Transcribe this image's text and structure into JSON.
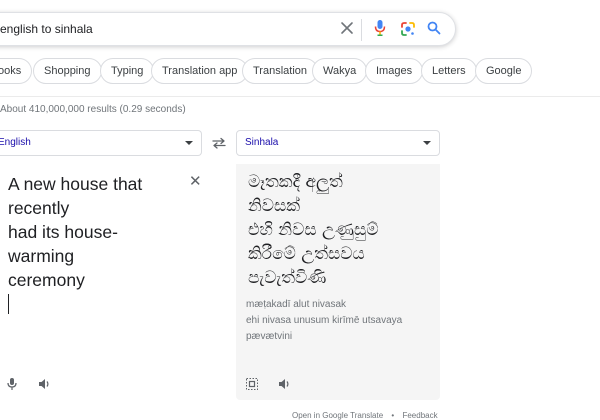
{
  "search": {
    "query": "english to sinhala",
    "icons": [
      "close-icon",
      "microphone-icon",
      "google-lens-icon",
      "search-icon"
    ]
  },
  "chips": [
    {
      "label": "ooks",
      "truncated": true
    },
    {
      "label": "Shopping"
    },
    {
      "label": "Typing"
    },
    {
      "label": "Translation app"
    },
    {
      "label": "Translation"
    },
    {
      "label": "Wakya"
    },
    {
      "label": "Images"
    },
    {
      "label": "Letters"
    },
    {
      "label": "Google"
    }
  ],
  "results_stats": "About 410,000,000 results (0.29 seconds)",
  "translator": {
    "source_lang": "English",
    "target_lang": "Sinhala",
    "swap_icon": "swap-arrows-icon",
    "source_text": "A new house that\nrecently\nhad its house-\nwarming\nceremony",
    "translated_text": "මෑතකදී අලුත්\nනිවසක්\nඑහි නිවස උණුසුම්\nකිරීමේ උත්සවය\nපැවැත්විණි",
    "transliteration": "mæṭakadī alut nivasak\nehi nivasa unusum kirīmē utsavaya\npævætvini",
    "source_icons": [
      "microphone-icon",
      "speaker-icon"
    ],
    "target_icons": [
      "copy-icon",
      "speaker-icon"
    ]
  },
  "footer": {
    "open_link": "Open in Google Translate",
    "separator": "•",
    "feedback": "Feedback"
  },
  "colors": {
    "link_blue": "#1a0dab",
    "google_blue": "#4285f4",
    "google_red": "#ea4335",
    "google_yellow": "#fbbc04",
    "google_green": "#34a853"
  }
}
